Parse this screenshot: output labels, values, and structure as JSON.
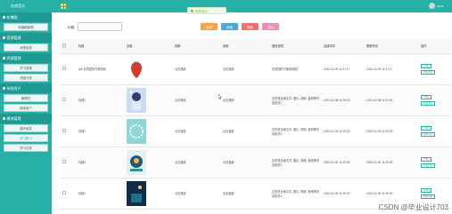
{
  "top": {
    "title": "在线音乐",
    "user": "admin"
  },
  "colors": {
    "accent": "#27b0a8",
    "success": "#67c23a",
    "btn_orange": "#f6a347",
    "btn_blue": "#4aa7d6",
    "btn_red": "#f26d6d",
    "btn_pink": "#f08fb4"
  },
  "sidebar": [
    {
      "label": "轮播图",
      "items": [
        "轮播图管理"
      ]
    },
    {
      "label": "资源管理",
      "items": [
        "资源信息"
      ]
    },
    {
      "label": "资源管理",
      "items": [
        "学习资源",
        "资源分类"
      ]
    },
    {
      "label": "系统用户",
      "items": [
        "管理员",
        "微信用户"
      ]
    },
    {
      "label": "模块管理",
      "items": [
        "模块信息",
        "学习练习",
        "学习记录"
      ]
    }
  ],
  "toast": {
    "text": "操作成功"
  },
  "search": {
    "label": "标题",
    "placeholder": ""
  },
  "buttons": {
    "query": "查询",
    "add": "新增",
    "delete": "删除",
    "export": "导出"
  },
  "table": {
    "columns": [
      "",
      "标题",
      "封面",
      "视频",
      "音频",
      "播放说明",
      "创建时间",
      "更新时间",
      "操作"
    ],
    "rows": [
      {
        "title": "qdf 去周园的青葡萄和",
        "video": "点击播放",
        "audio": "点击播放",
        "desc": "去周园的青葡萄和园",
        "created": "2023-02-09 11:37:17",
        "updated": "2023-02-09 11:37:17",
        "thumb": "strawberry"
      },
      {
        "title": "标题1",
        "video": "点击播放",
        "audio": "点击播放",
        "desc": "这些是全局文件, 图片, 视频, 音频等内容相关1",
        "created": "2023-02-09 11:29:29",
        "updated": "2023-02-09 11:31:03",
        "thumb": "girl"
      },
      {
        "title": "标题2",
        "video": "点击播放",
        "audio": "点击播放",
        "desc": "这些是全局文件, 图片, 视频, 音频等内容相关2",
        "created": "2023-02-09 11:29:29",
        "updated": "2023-02-09 11:29:29",
        "thumb": "wreath"
      },
      {
        "title": "标题3",
        "video": "点击播放",
        "audio": "点击播放",
        "desc": "这些是全局文件, 图片, 视频, 音频等内容相关3",
        "created": "2023-02-09 11:29:29",
        "updated": "2023-02-09 11:29:29",
        "thumb": "music"
      },
      {
        "title": "标题4",
        "video": "点击播放",
        "audio": "点击播放",
        "desc": "这些是全局文件, 图片, 视频, 音频等内容相关4",
        "created": "2023-02-09 11:29:29",
        "updated": "2023-02-09 11:29:29",
        "thumb": "night"
      }
    ],
    "ops": {
      "detail": "详情",
      "comment": "查看评论"
    }
  },
  "watermark": "CSDN @毕业设计703"
}
